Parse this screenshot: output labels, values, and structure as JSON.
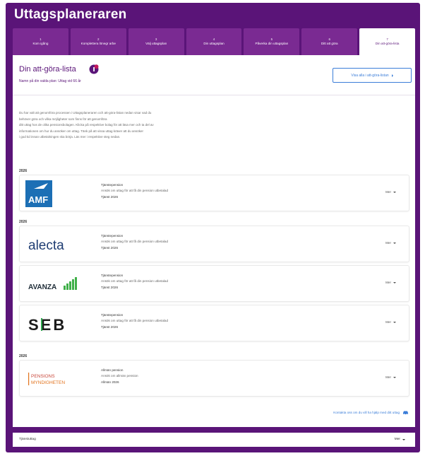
{
  "app": {
    "title": "Uttagsplaneraren"
  },
  "colors": {
    "brand": "#5a1478",
    "accent": "#3b7dd8",
    "badge": "#c2185b"
  },
  "steps": [
    {
      "num": "1",
      "label": "Kom igång"
    },
    {
      "num": "2",
      "label": "Komplettera lönegr arbe"
    },
    {
      "num": "3",
      "label": "Välj uttagsplan"
    },
    {
      "num": "4",
      "label": "Din uttagsplan"
    },
    {
      "num": "5",
      "label": "Påverka din uttagsplan"
    },
    {
      "num": "6",
      "label": "Ditt att göra"
    },
    {
      "num": "7",
      "label": "Din att-göra-lista"
    }
  ],
  "header": {
    "list_title": "Din att-göra-lista",
    "badge_icon": "notification-badge-icon",
    "subtitle": "Namn på din valda plan: Uttag vid 66 år",
    "action_label": "Visa alla i att-göra-listan",
    "action_icon": "chevron-right-icon"
  },
  "description": {
    "lines": [
      "Du har valt att genomföra processen i Uttagsplaneraren och att-göra-listan nedan visar vad du",
      "behöver göra och vilka möjligheter som finns för att genomföra",
      "ditt uttag hos de olika pensionsbolagen. Klicka på respektive bolag för att läsa mer och ta del av",
      "informationen om hur du ansöker om uttag. Tänk på att vissa uttag kräver att du ansöker",
      "i god tid innan utbetalningen ska börja. Läs mer i respektive steg nedan."
    ]
  },
  "groups": [
    {
      "year": "2026",
      "items": [
        {
          "logo": "AMF",
          "title": "Tjänstepension",
          "text": "Ansök om uttag för att få din pension utbetalad",
          "type": "Tjänst 2026",
          "more": "Mer"
        }
      ]
    },
    {
      "year": "2026",
      "items": [
        {
          "logo": "alecta",
          "title": "Tjänstepension",
          "text": "Ansök om uttag för att få din pension utbetalad",
          "type": "Tjänst 2026",
          "more": "Mer"
        },
        {
          "logo": "AVANZA",
          "title": "Tjänstepension",
          "text": "Ansök om uttag för att få din pension utbetalad",
          "type": "Tjänst 2026",
          "more": "Mer"
        },
        {
          "logo": "SEB",
          "title": "Tjänstepension",
          "text": "Ansök om uttag för att få din pension utbetalad",
          "type": "Tjänst 2026",
          "more": "Mer"
        }
      ]
    },
    {
      "year": "2026",
      "items": [
        {
          "logo": "PENSIONSMYNDIGHETEN",
          "title": "Allmän pension",
          "text": "Ansök om allmän pension",
          "type": "Allmän 2026",
          "more": "Mer"
        }
      ]
    }
  ],
  "help_link": {
    "label": "Kontakta oss om du vill ha hjälp med ditt uttag",
    "icon": "car-icon"
  },
  "footer": {
    "label": "Tjänstuttag",
    "more": "Mer"
  },
  "logo_text": {
    "amf": "AMF",
    "alecta": "alecta",
    "avanza": "AVANZA",
    "seb": "SEB",
    "pm1": "PENSIONS",
    "pm2": "MYNDIGHETEN"
  }
}
